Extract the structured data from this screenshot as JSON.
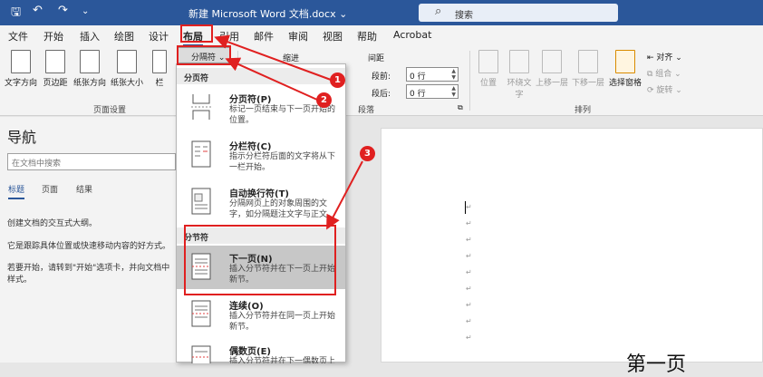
{
  "titlebar": {
    "doc_title": "新建 Microsoft Word 文档.docx ⌄",
    "search_placeholder": "搜索",
    "qa_save": "🖫",
    "qa_undo": "↶",
    "qa_redo": "↷",
    "qa_more": "⌄"
  },
  "tabs": [
    {
      "label": "文件"
    },
    {
      "label": "开始"
    },
    {
      "label": "插入"
    },
    {
      "label": "绘图"
    },
    {
      "label": "设计"
    },
    {
      "label": "布局"
    },
    {
      "label": "引用"
    },
    {
      "label": "邮件"
    },
    {
      "label": "审阅"
    },
    {
      "label": "视图"
    },
    {
      "label": "帮助"
    },
    {
      "label": "Acrobat"
    }
  ],
  "ribbon": {
    "page_setup_buttons": [
      {
        "label": "文字方向"
      },
      {
        "label": "页边距"
      },
      {
        "label": "纸张方向"
      },
      {
        "label": "纸张大小"
      },
      {
        "label": "栏"
      }
    ],
    "page_setup_group": "页面设置",
    "breaks_button": "分隔符 ⌄",
    "indent_label": "缩进",
    "spacing_label": "间距",
    "spacing_before_label": "段前:",
    "spacing_after_label": "段后:",
    "spacing_before_value": "0 行",
    "spacing_after_value": "0 行",
    "paragraph_group": "段落",
    "arrange_buttons": [
      {
        "label": "位置"
      },
      {
        "label": "环绕文字"
      },
      {
        "label": "上移一层"
      },
      {
        "label": "下移一层"
      },
      {
        "label": "选择窗格"
      }
    ],
    "align_label": "对齐 ⌄",
    "group_label": "组合 ⌄",
    "rotate_label": "旋转 ⌄",
    "arrange_group": "排列"
  },
  "nav": {
    "title": "导航",
    "search_placeholder": "在文档中搜索",
    "tabs": [
      "标题",
      "页面",
      "结果"
    ],
    "lines": [
      "创建文档的交互式大纲。",
      "它是跟踪具体位置或快速移动内容的好方式。",
      "若要开始，请转到\"开始\"选项卡，并向文档中",
      "样式。"
    ]
  },
  "dropdown": {
    "page_breaks_header": "分页符",
    "section_breaks_header": "分节符",
    "items": [
      {
        "title": "分页符(P)",
        "desc": "标记一页结束与下一页开始的位置。"
      },
      {
        "title": "分栏符(C)",
        "desc": "指示分栏符后面的文字将从下一栏开始。"
      },
      {
        "title": "自动换行符(T)",
        "desc": "分隔网页上的对象周围的文字，如分隔题注文字与正文。"
      },
      {
        "title": "下一页(N)",
        "desc": "插入分节符并在下一页上开始新节。"
      },
      {
        "title": "连续(O)",
        "desc": "插入分节符并在同一页上开始新节。"
      },
      {
        "title": "偶数页(E)",
        "desc": "插入分节符并在下一偶数页上"
      }
    ]
  },
  "document": {
    "bigtext": "第一页",
    "para_mark": "↵"
  },
  "annotations": [
    "1",
    "2",
    "3"
  ],
  "colors": {
    "accent": "#2b579a",
    "annotation": "#e02020"
  }
}
